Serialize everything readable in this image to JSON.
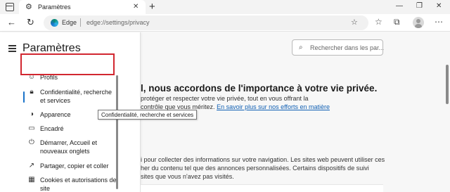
{
  "tab": {
    "title": "Paramètres"
  },
  "address": {
    "site_name": "Edge",
    "url": "edge://settings/privacy"
  },
  "sidebar": {
    "title": "Paramètres",
    "items": [
      {
        "label": "Profils",
        "icon": "profile-icon"
      },
      {
        "label": "Confidentialité, recherche et services",
        "icon": "lock-icon",
        "active": true
      },
      {
        "label": "Apparence",
        "icon": "appearance-icon"
      },
      {
        "label": "Encadré",
        "icon": "sidebar-panel-icon"
      },
      {
        "label": "Démarrer, Accueil et nouveaux onglets",
        "icon": "power-icon"
      },
      {
        "label": "Partager, copier et coller",
        "icon": "share-icon"
      },
      {
        "label": "Cookies et autorisations de site",
        "icon": "cookies-icon"
      }
    ],
    "tooltip": "Confidentialité, recherche et services"
  },
  "search": {
    "placeholder": "Rechercher dans les par..."
  },
  "main": {
    "heading": "l, nous accordons de l'importance à votre vie privée.",
    "para1_line1": "protéger et respecter votre vie privée, tout en vous offrant la",
    "para1_line2_prefix": "contrôle que vous méritez.",
    "para1_link": "En savoir plus sur nos efforts en matière",
    "para2_line1": "i pour collecter des informations sur votre navigation. Les sites web peuvent utiliser ces",
    "para2_line2": "her du contenu tel que des annonces personnalisées. Certains dispositifs de suivi",
    "para2_line3": "sites que vous n'avez pas visités."
  },
  "colors": {
    "highlight": "#d22730",
    "link": "#1160b4",
    "active_accent": "#1a73c9"
  }
}
